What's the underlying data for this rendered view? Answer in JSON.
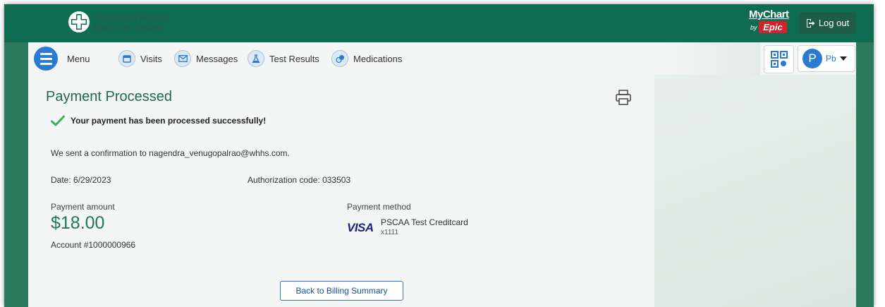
{
  "header": {
    "org_name_line1": "Washington Hospital",
    "org_name_line2": "Healthcare System",
    "mychart_label": "MyChart",
    "mychart_by": "by",
    "epic_label": "Epic",
    "logout_label": "Log out"
  },
  "nav": {
    "menu_label": "Menu",
    "items": [
      {
        "label": "Visits",
        "icon": "calendar-icon"
      },
      {
        "label": "Messages",
        "icon": "envelope-icon"
      },
      {
        "label": "Test Results",
        "icon": "flask-icon"
      },
      {
        "label": "Medications",
        "icon": "pill-icon"
      }
    ],
    "profile_avatar": "P",
    "profile_initials": "Pb"
  },
  "payment": {
    "title": "Payment Processed",
    "success_message": "Your payment has been processed successfully!",
    "confirmation_text": "We sent a confirmation to nagendra_venugopalrao@whhs.com.",
    "date_label": "Date:",
    "date_value": "6/29/2023",
    "auth_label": "Authorization code:",
    "auth_value": "033503",
    "amount_label": "Payment amount",
    "amount_value": "$18.00",
    "account": "Account #1000000966",
    "method_label": "Payment method",
    "card_brand": "VISA",
    "card_name": "PSCAA Test Creditcard",
    "card_last": "x1111",
    "back_button": "Back to Billing Summary"
  },
  "colors": {
    "brand_green": "#0f6c51",
    "title_green": "#1d6a4f",
    "accent_blue": "#2a7ad2",
    "success_green": "#3fae5c"
  }
}
